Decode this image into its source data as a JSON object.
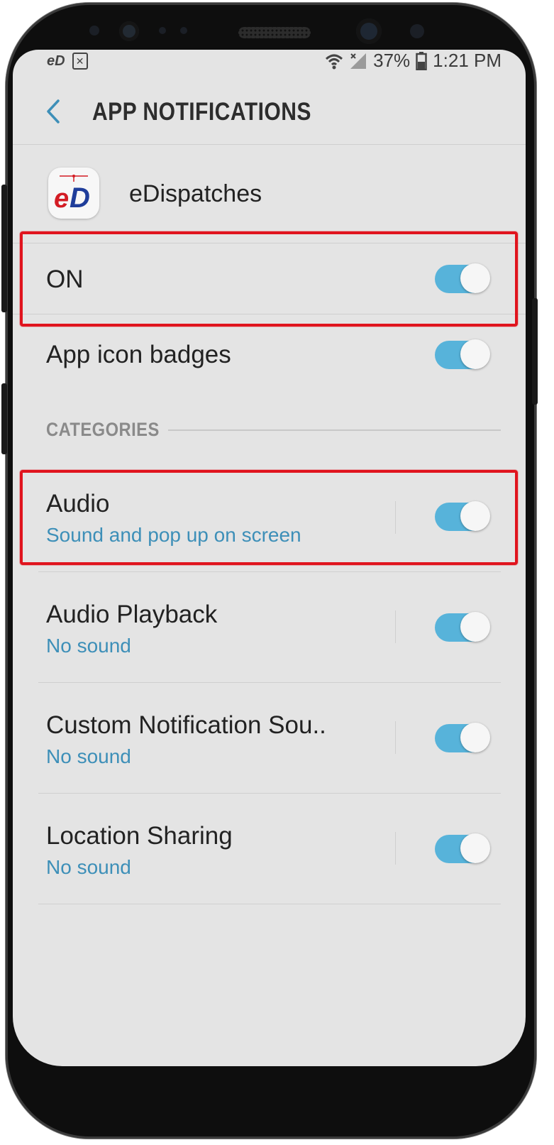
{
  "status_bar": {
    "left_app_logo": "eD",
    "battery_percent": "37%",
    "time": "1:21 PM",
    "icons": [
      "wifi-icon",
      "signal-icon",
      "battery-icon",
      "close-box-icon"
    ]
  },
  "header": {
    "title": "APP NOTIFICATIONS",
    "back_icon": "chevron-left-icon"
  },
  "app": {
    "name": "eDispatches",
    "logo_text": "eD"
  },
  "master_toggle": {
    "label": "ON",
    "on": true
  },
  "badges_toggle": {
    "label": "App icon badges",
    "on": true
  },
  "categories_header": "CATEGORIES",
  "categories": [
    {
      "title": "Audio",
      "subtitle": "Sound and pop up on screen",
      "on": true
    },
    {
      "title": "Audio Playback",
      "subtitle": "No sound",
      "on": true
    },
    {
      "title": "Custom Notification Sou..",
      "subtitle": "No sound",
      "on": true
    },
    {
      "title": "Location Sharing",
      "subtitle": "No sound",
      "on": true
    }
  ],
  "colors": {
    "accent": "#57b3da",
    "subtitle": "#3d8fb8",
    "highlight": "#e0141e",
    "screen_bg": "#e4e4e4"
  }
}
